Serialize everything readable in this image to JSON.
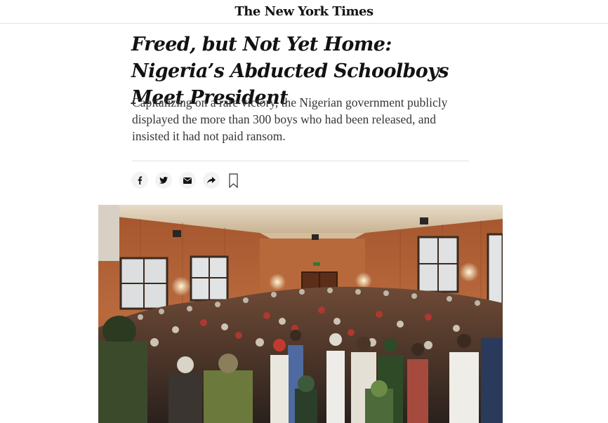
{
  "masthead": {
    "logo_text": "The New York Times"
  },
  "article": {
    "headline": "Freed, but Not Yet Home: Nigeria’s Abducted Schoolboys Meet President",
    "summary": "Capitalizing on a rare victory, the Nigerian government publicly displayed the more than 300 boys who had been released, and insisted it had not paid ransom."
  },
  "share_tools": [
    {
      "icon": "facebook-icon"
    },
    {
      "icon": "twitter-icon"
    },
    {
      "icon": "email-icon"
    },
    {
      "icon": "share-arrow-icon"
    },
    {
      "icon": "bookmark-icon"
    }
  ],
  "colors": {
    "text": "#121212",
    "summary_text": "#363636",
    "rule": "#e2e2e2",
    "share_bg": "#f3f3f3",
    "wood_panel": "#b0643a"
  }
}
